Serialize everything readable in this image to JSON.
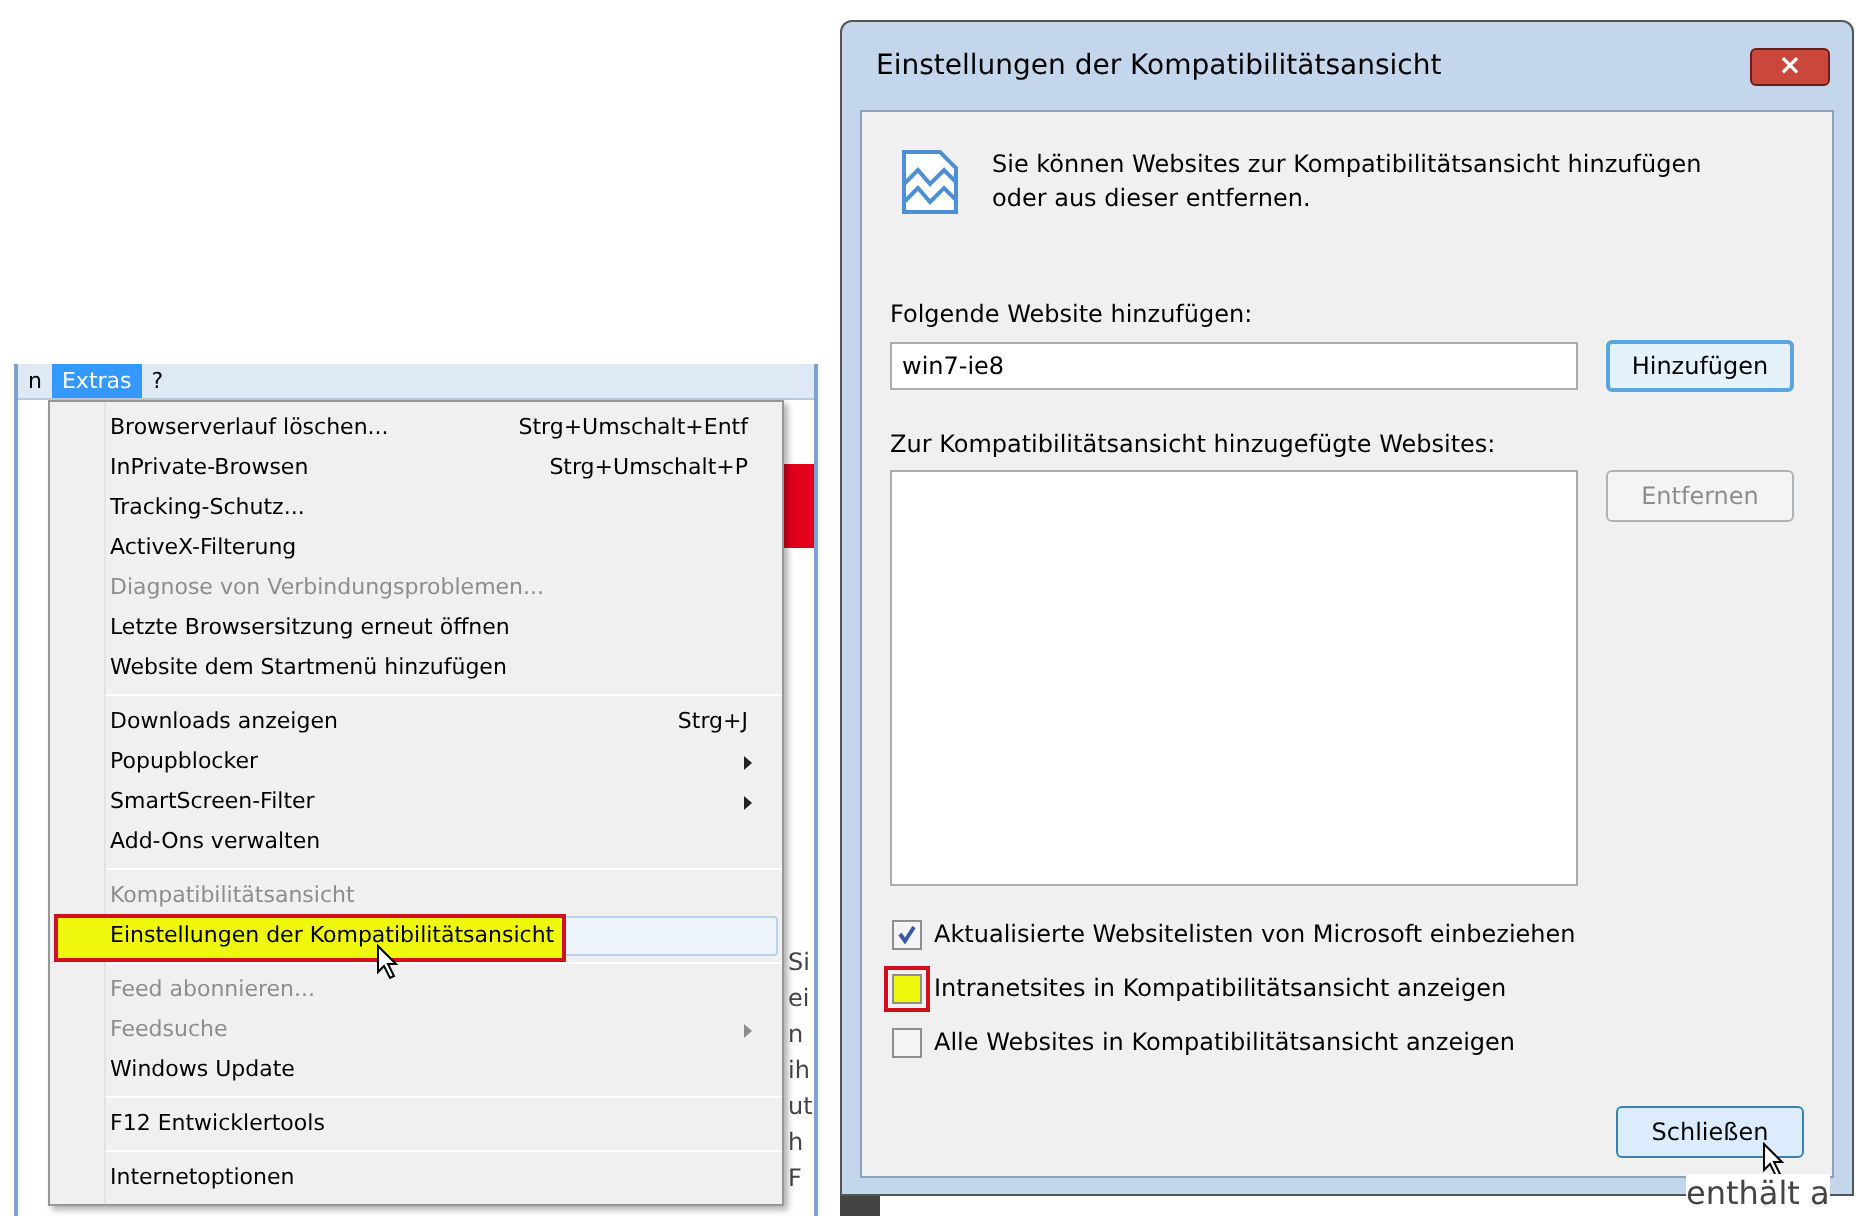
{
  "browser": {
    "menubar": [
      {
        "label": "n",
        "selected": false
      },
      {
        "label": "Extras",
        "selected": true
      },
      {
        "label": "?",
        "selected": false
      }
    ],
    "page_fragments": [
      "Si",
      "ei",
      "n",
      "ih",
      "ut",
      "h",
      "F"
    ],
    "menu": [
      [
        {
          "label": "Browserverlauf löschen...",
          "shortcut": "Strg+Umschalt+Entf",
          "disabled": false,
          "submenu": false,
          "selected": false
        },
        {
          "label": "InPrivate-Browsen",
          "shortcut": "Strg+Umschalt+P",
          "disabled": false,
          "submenu": false,
          "selected": false
        },
        {
          "label": "Tracking-Schutz...",
          "disabled": false,
          "submenu": false,
          "selected": false
        },
        {
          "label": "ActiveX-Filterung",
          "disabled": false,
          "submenu": false,
          "selected": false
        },
        {
          "label": "Diagnose von Verbindungsproblemen...",
          "disabled": true,
          "submenu": false,
          "selected": false
        },
        {
          "label": "Letzte Browsersitzung erneut öffnen",
          "disabled": false,
          "submenu": false,
          "selected": false
        },
        {
          "label": "Website dem Startmenü hinzufügen",
          "disabled": false,
          "submenu": false,
          "selected": false
        }
      ],
      [
        {
          "label": "Downloads anzeigen",
          "shortcut": "Strg+J",
          "disabled": false,
          "submenu": false,
          "selected": false
        },
        {
          "label": "Popupblocker",
          "disabled": false,
          "submenu": true,
          "selected": false
        },
        {
          "label": "SmartScreen-Filter",
          "disabled": false,
          "submenu": true,
          "selected": false
        },
        {
          "label": "Add-Ons verwalten",
          "disabled": false,
          "submenu": false,
          "selected": false
        }
      ],
      [
        {
          "label": "Kompatibilitätsansicht",
          "disabled": true,
          "submenu": false,
          "selected": false
        },
        {
          "label": "Einstellungen der Kompatibilitätsansicht",
          "disabled": false,
          "submenu": false,
          "selected": true
        }
      ],
      [
        {
          "label": "Feed abonnieren...",
          "disabled": true,
          "submenu": false,
          "selected": false
        },
        {
          "label": "Feedsuche",
          "disabled": true,
          "submenu": true,
          "selected": false
        },
        {
          "label": "Windows Update",
          "disabled": false,
          "submenu": false,
          "selected": false
        }
      ],
      [
        {
          "label": "F12 Entwicklertools",
          "disabled": false,
          "submenu": false,
          "selected": false
        }
      ],
      [
        {
          "label": "Internetoptionen",
          "disabled": false,
          "submenu": false,
          "selected": false
        }
      ]
    ]
  },
  "dialog": {
    "title": "Einstellungen der Kompatibilitätsansicht",
    "close": "×",
    "intro": "Sie können Websites zur Kompatibilitätsansicht hinzufügen oder aus dieser entfernen.",
    "add_label": "Folgende Website hinzufügen:",
    "add_value": "win7-ie8",
    "add_button": "Hinzufügen",
    "list_label": "Zur Kompatibilitätsansicht hinzugefügte Websites:",
    "remove_button": {
      "label": "Entfernen",
      "disabled": true
    },
    "checkboxes": [
      {
        "label": "Aktualisierte Websitelisten von Microsoft einbeziehen",
        "checked": true,
        "highlighted": false
      },
      {
        "label": "Intranetsites in Kompatibilitätsansicht anzeigen",
        "checked": false,
        "highlighted": true
      },
      {
        "label": "Alle Websites in Kompatibilitätsansicht anzeigen",
        "checked": false,
        "highlighted": false
      }
    ],
    "close_button": "Schließen"
  },
  "background_fragment": "enthält a"
}
